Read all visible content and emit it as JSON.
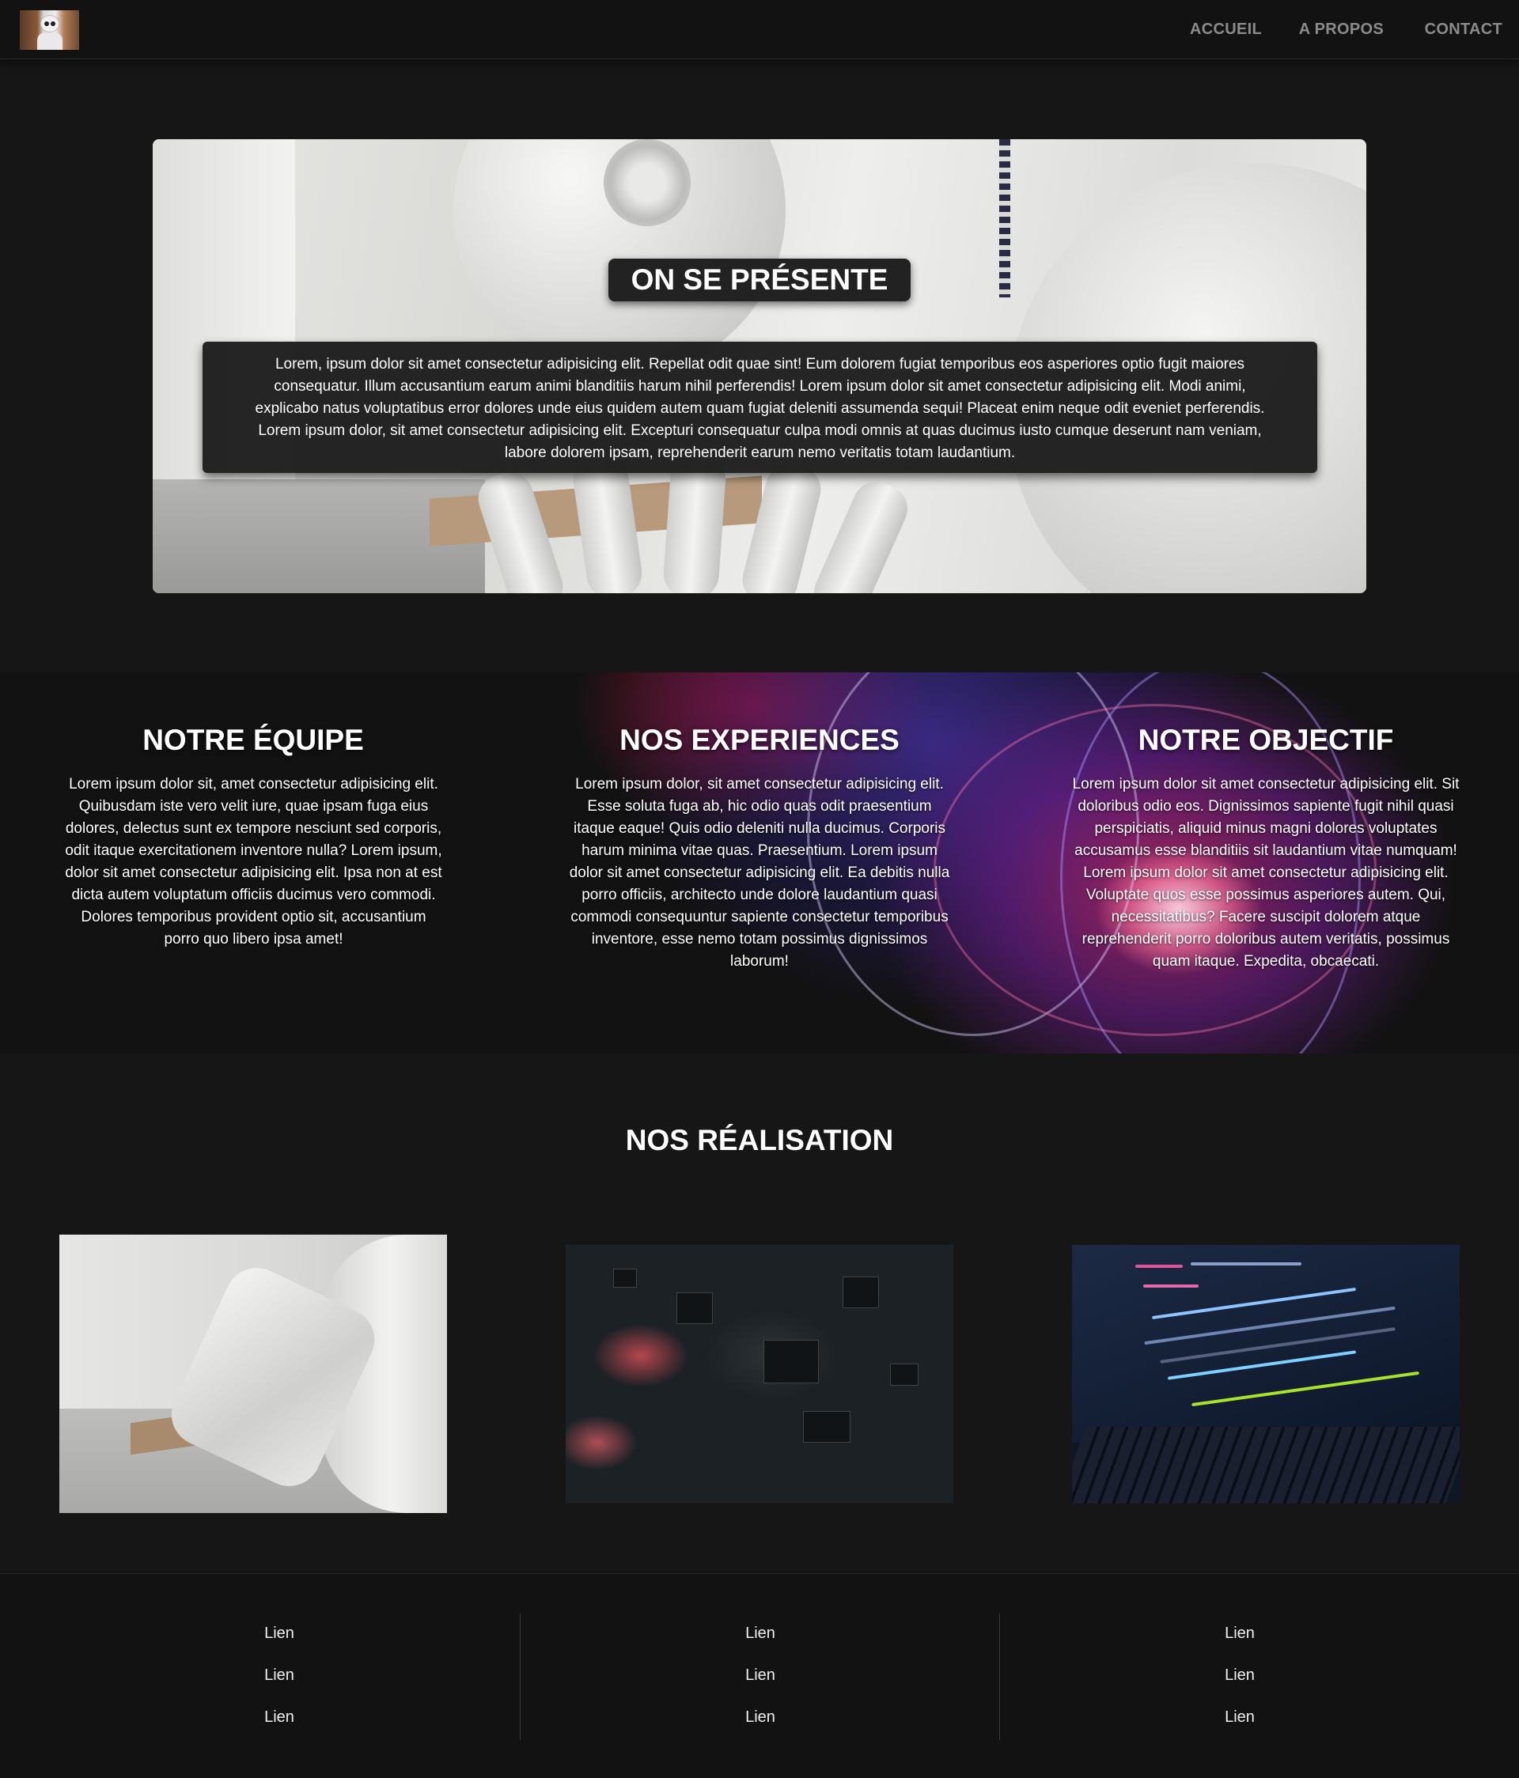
{
  "nav": {
    "links": [
      "ACCUEIL",
      "A PROPOS",
      "CONTACT"
    ]
  },
  "hero": {
    "title": "ON SE PRÉSENTE",
    "text": "Lorem, ipsum dolor sit amet consectetur adipisicing elit. Repellat odit quae sint! Eum dolorem fugiat temporibus eos asperiores optio fugit maiores consequatur. Illum accusantium earum animi blanditiis harum nihil perferendis! Lorem ipsum dolor sit amet consectetur adipisicing elit. Modi animi, explicabo natus voluptatibus error dolores unde eius quidem autem quam fugiat deleniti assumenda sequi! Placeat enim neque odit eveniet perferendis. Lorem ipsum dolor, sit amet consectetur adipisicing elit. Excepturi consequatur culpa modi omnis at quas ducimus iusto cumque deserunt nam veniam, labore dolorem ipsam, reprehenderit earum nemo veritatis totam laudantium."
  },
  "features": [
    {
      "title": "NOTRE ÉQUIPE",
      "text": "Lorem ipsum dolor sit, amet consectetur adipisicing elit. Quibusdam iste vero velit iure, quae ipsam fuga eius dolores, delectus sunt ex tempore nesciunt sed corporis, odit itaque exercitationem inventore nulla? Lorem ipsum, dolor sit amet consectetur adipisicing elit. Ipsa non at est dicta autem voluptatum officiis ducimus vero commodi. Dolores temporibus provident optio sit, accusantium porro quo libero ipsa amet!"
    },
    {
      "title": "NOS EXPERIENCES",
      "text": "Lorem ipsum dolor, sit amet consectetur adipisicing elit. Esse soluta fuga ab, hic odio quas odit praesentium itaque eaque! Quis odio deleniti nulla ducimus. Corporis harum minima vitae quas. Praesentium. Lorem ipsum dolor sit amet consectetur adipisicing elit. Ea debitis nulla porro officiis, architecto unde dolore laudantium quasi commodi consequuntur sapiente consectetur temporibus inventore, esse nemo totam possimus dignissimos laborum!"
    },
    {
      "title": "NOTRE OBJECTIF",
      "text": "Lorem ipsum dolor sit amet consectetur adipisicing elit. Sit doloribus odio eos. Dignissimos sapiente fugit nihil quasi perspiciatis, aliquid minus magni dolores voluptates accusamus esse blanditiis sit laudantium vitae numquam! Lorem ipsum dolor sit amet consectetur adipisicing elit. Voluptate quos esse possimus asperiores autem. Qui, necessitatibus? Facere suscipit dolorem atque reprehenderit porro doloribus autem veritatis, possimus quam itaque. Expedita, obcaecati."
    }
  ],
  "realisations": {
    "title": "NOS RÉALISATION"
  },
  "footer": {
    "columns": [
      [
        "Lien",
        "Lien",
        "Lien"
      ],
      [
        "Lien",
        "Lien",
        "Lien"
      ],
      [
        "Lien",
        "Lien",
        "Lien"
      ]
    ]
  },
  "colors": {
    "background": "#161617",
    "nav_background": "#121213",
    "nav_link": "#8b8b8e",
    "text": "#ffffff"
  },
  "icons": {
    "logo": "robot-logo-icon"
  }
}
